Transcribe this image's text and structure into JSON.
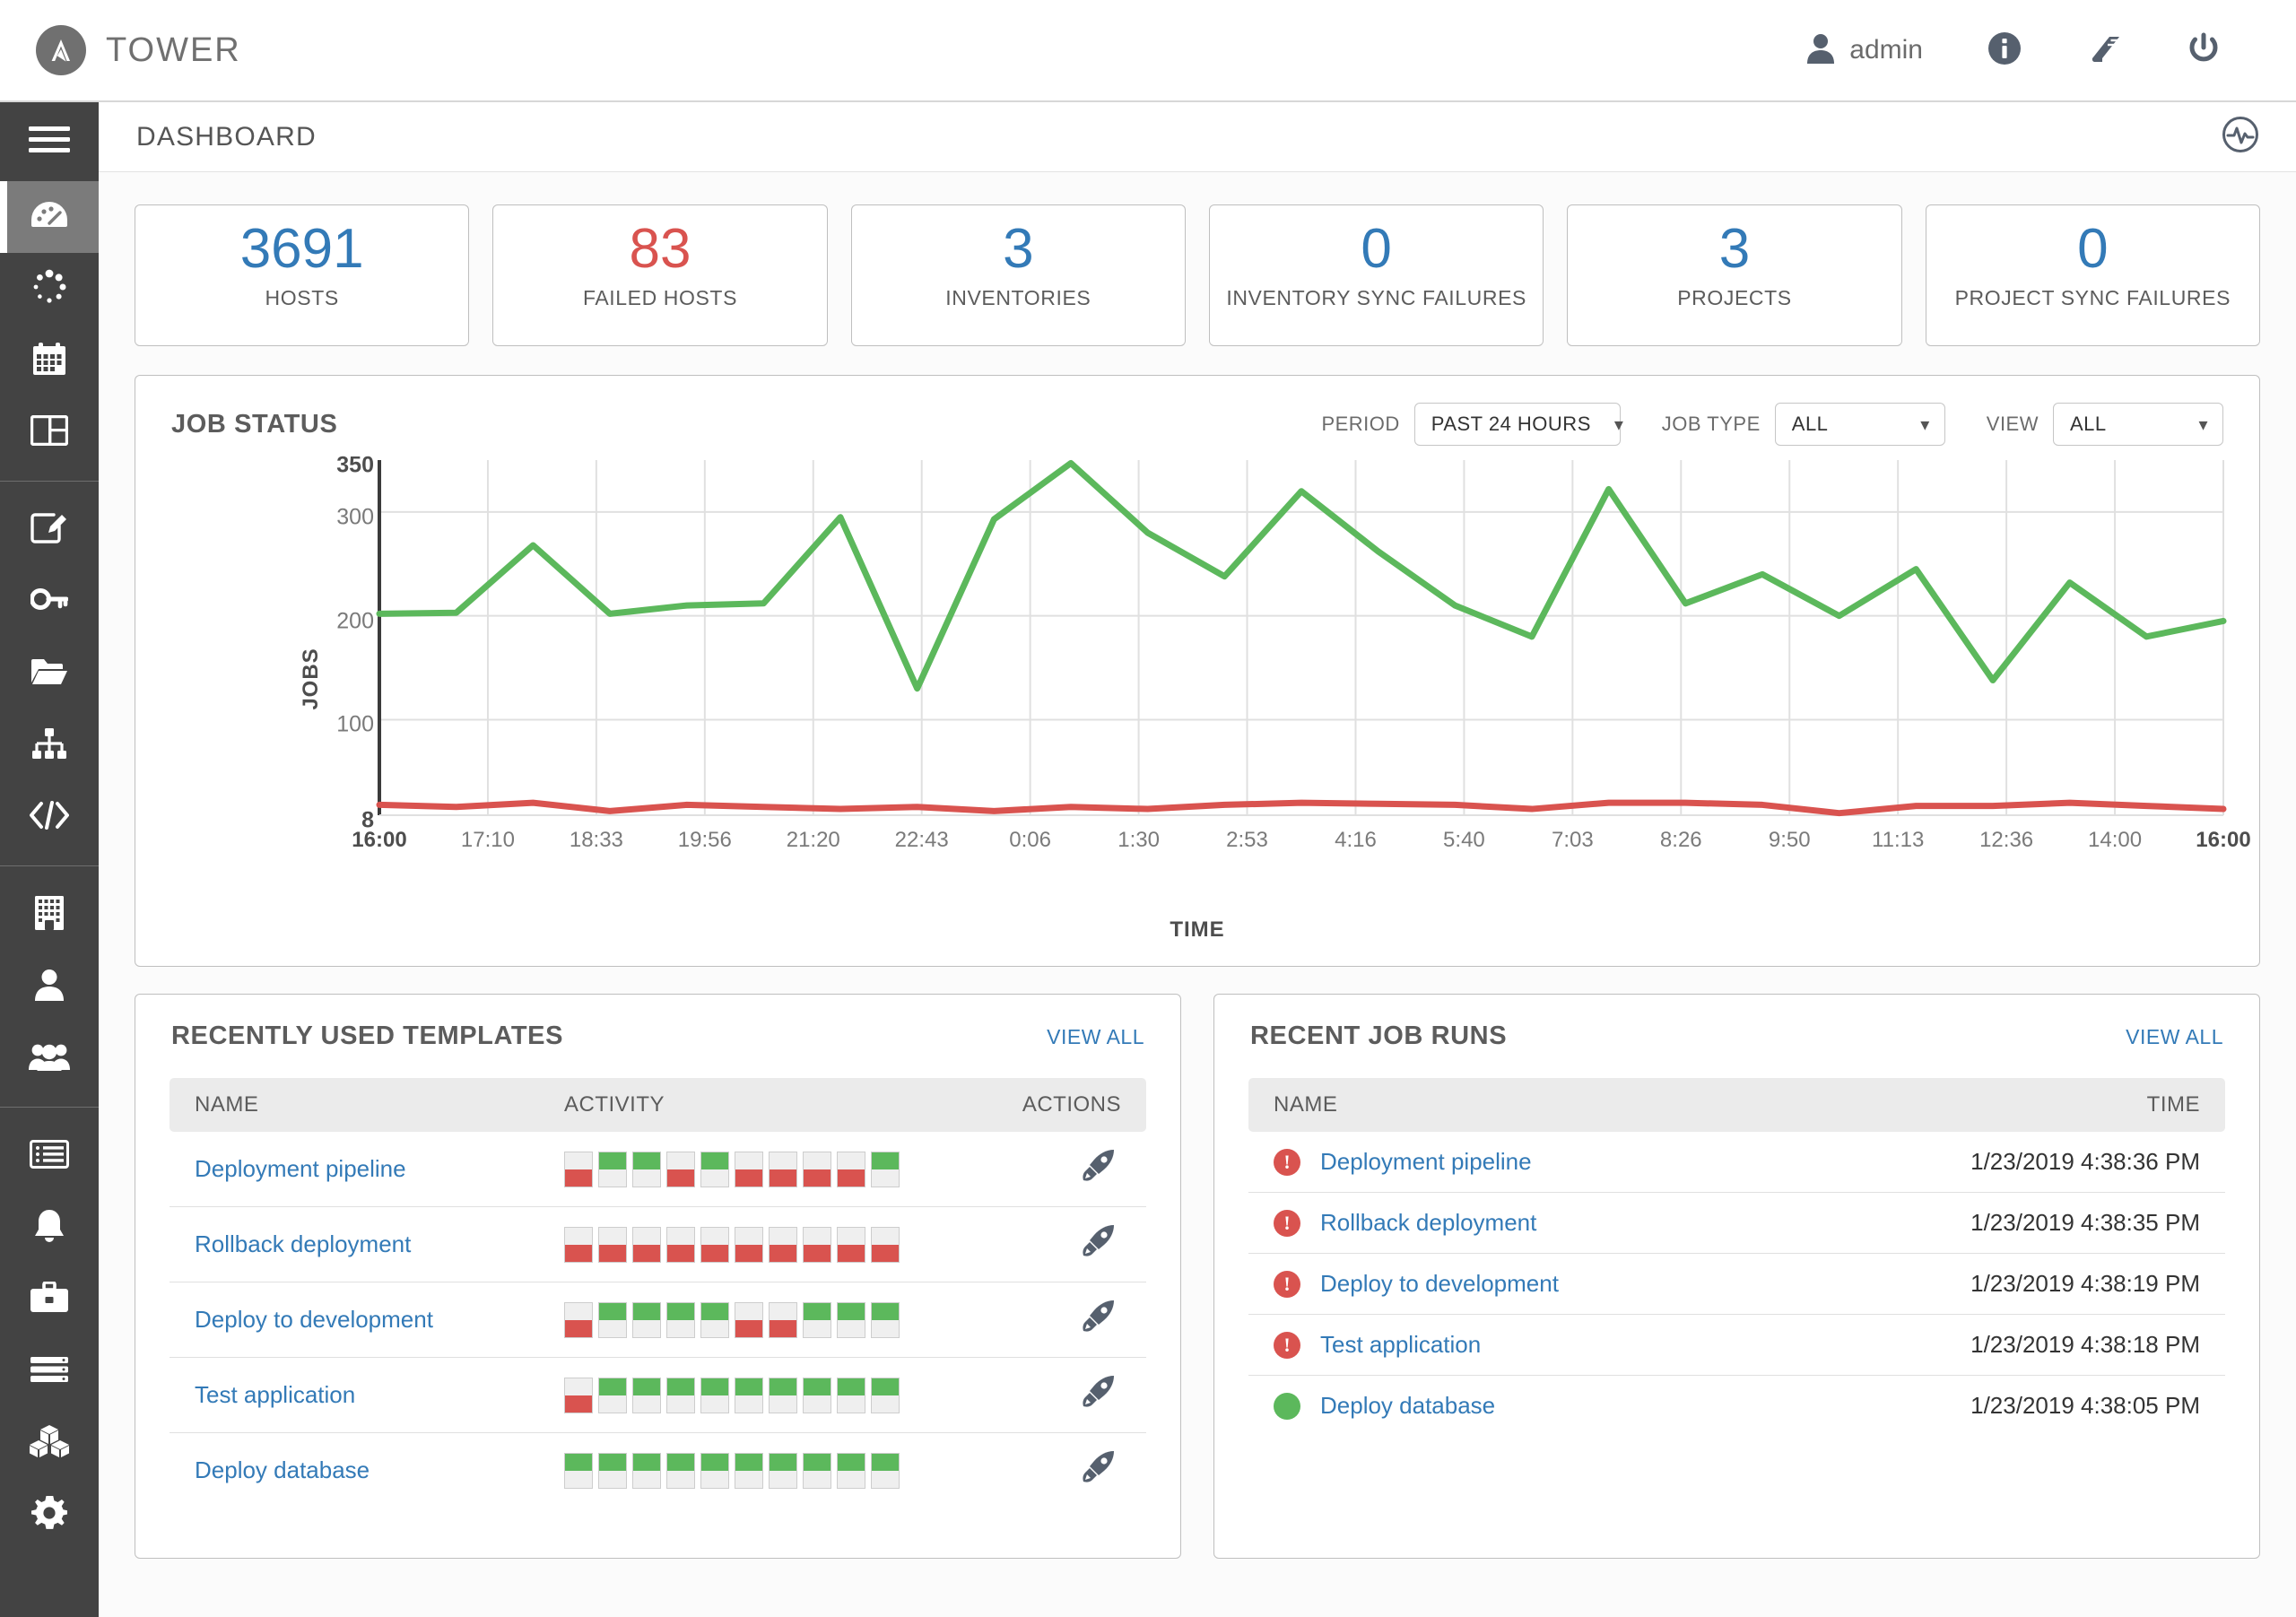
{
  "header": {
    "brand": "TOWER",
    "logo_icon": "ansible-logo-icon",
    "user_label": "admin",
    "user_icon": "user-icon",
    "info_icon": "info-circle-icon",
    "docs_icon": "book-icon",
    "logout_icon": "power-icon"
  },
  "sidebar": {
    "menu_icon": "hamburger-icon",
    "items": [
      {
        "name": "dashboard",
        "icon": "dashboard-gauge-icon",
        "active": true
      },
      {
        "name": "jobs",
        "icon": "jobs-dots-icon",
        "active": false
      },
      {
        "name": "schedules",
        "icon": "calendar-icon",
        "active": false
      },
      {
        "name": "portal-mode",
        "icon": "columns-icon",
        "active": false
      },
      {
        "name": "templates",
        "icon": "pencil-square-icon",
        "active": false,
        "sep_before": true
      },
      {
        "name": "credentials",
        "icon": "key-icon",
        "active": false
      },
      {
        "name": "projects",
        "icon": "folder-open-icon",
        "active": false
      },
      {
        "name": "inventories",
        "icon": "sitemap-icon",
        "active": false
      },
      {
        "name": "inventory-scripts",
        "icon": "code-icon",
        "active": false
      },
      {
        "name": "organizations",
        "icon": "building-icon",
        "active": false,
        "sep_before": true
      },
      {
        "name": "users",
        "icon": "user-icon",
        "active": false
      },
      {
        "name": "teams",
        "icon": "users-group-icon",
        "active": false
      },
      {
        "name": "management-jobs",
        "icon": "list-icon",
        "active": false,
        "sep_before": true
      },
      {
        "name": "notifications",
        "icon": "bell-icon",
        "active": false
      },
      {
        "name": "instance-groups",
        "icon": "briefcase-icon",
        "active": false
      },
      {
        "name": "applications",
        "icon": "server-stack-icon",
        "active": false
      },
      {
        "name": "integrations",
        "icon": "cubes-icon",
        "active": false
      },
      {
        "name": "settings",
        "icon": "gear-icon",
        "active": false
      }
    ]
  },
  "breadcrumb": {
    "title": "DASHBOARD",
    "activity_icon": "activity-stream-icon"
  },
  "stats": [
    {
      "value": "3691",
      "label": "HOSTS",
      "color": "blue"
    },
    {
      "value": "83",
      "label": "FAILED HOSTS",
      "color": "red"
    },
    {
      "value": "3",
      "label": "INVENTORIES",
      "color": "blue"
    },
    {
      "value": "0",
      "label": "INVENTORY SYNC FAILURES",
      "color": "blue"
    },
    {
      "value": "3",
      "label": "PROJECTS",
      "color": "blue"
    },
    {
      "value": "0",
      "label": "PROJECT SYNC FAILURES",
      "color": "blue"
    }
  ],
  "job_status": {
    "title": "JOB STATUS",
    "filters": [
      {
        "name": "period",
        "label": "PERIOD",
        "value": "PAST 24 HOURS"
      },
      {
        "name": "job-type",
        "label": "JOB TYPE",
        "value": "ALL"
      },
      {
        "name": "view",
        "label": "VIEW",
        "value": "ALL"
      }
    ]
  },
  "chart_data": {
    "type": "line",
    "title": "JOB STATUS",
    "xlabel": "TIME",
    "ylabel": "JOBS",
    "ylim": [
      8,
      350
    ],
    "yticks": [
      8,
      100,
      200,
      300,
      350
    ],
    "ytick_labels": [
      "8",
      "100",
      "200",
      "300",
      "350"
    ],
    "grid": true,
    "legend": "none",
    "x": [
      "16:00",
      "17:10",
      "18:33",
      "19:56",
      "21:20",
      "22:43",
      "0:06",
      "1:30",
      "2:53",
      "4:16",
      "5:40",
      "7:03",
      "8:26",
      "9:50",
      "11:13",
      "12:36",
      "14:00",
      "16:00"
    ],
    "xtick_bold": [
      0,
      17
    ],
    "series": [
      {
        "name": "successful",
        "color": "#5cb85c",
        "values": [
          202,
          203,
          268,
          202,
          210,
          212,
          295,
          130,
          293,
          347,
          280,
          238,
          320,
          262,
          210,
          180,
          322,
          212,
          240,
          200,
          245,
          138,
          232,
          180,
          195
        ]
      },
      {
        "name": "failed",
        "color": "#d9534f",
        "values": [
          18,
          16,
          20,
          12,
          18,
          16,
          14,
          16,
          12,
          16,
          14,
          18,
          20,
          19,
          18,
          14,
          20,
          20,
          18,
          10,
          17,
          17,
          20,
          17,
          14
        ]
      }
    ]
  },
  "templates_panel": {
    "title": "RECENTLY USED TEMPLATES",
    "view_all": "VIEW ALL",
    "columns": [
      "NAME",
      "ACTIVITY",
      "ACTIONS"
    ],
    "launch_icon": "rocket-icon",
    "rows": [
      {
        "name": "Deployment pipeline",
        "activity": [
          "fail",
          "ok",
          "ok",
          "fail",
          "ok",
          "fail",
          "fail",
          "fail",
          "fail",
          "ok"
        ]
      },
      {
        "name": "Rollback deployment",
        "activity": [
          "fail",
          "fail",
          "fail",
          "fail",
          "fail",
          "fail",
          "fail",
          "fail",
          "fail",
          "fail"
        ]
      },
      {
        "name": "Deploy to development",
        "activity": [
          "fail",
          "ok",
          "ok",
          "ok",
          "ok",
          "fail",
          "fail",
          "ok",
          "ok",
          "ok"
        ]
      },
      {
        "name": "Test application",
        "activity": [
          "fail",
          "ok",
          "ok",
          "ok",
          "ok",
          "ok",
          "ok",
          "ok",
          "ok",
          "ok"
        ]
      },
      {
        "name": "Deploy database",
        "activity": [
          "ok",
          "ok",
          "ok",
          "ok",
          "ok",
          "ok",
          "ok",
          "ok",
          "ok",
          "ok"
        ]
      }
    ]
  },
  "jobs_panel": {
    "title": "RECENT JOB RUNS",
    "view_all": "VIEW ALL",
    "columns": [
      "NAME",
      "TIME"
    ],
    "rows": [
      {
        "name": "Deployment pipeline",
        "time": "1/23/2019 4:38:36 PM",
        "status": "failed"
      },
      {
        "name": "Rollback deployment",
        "time": "1/23/2019 4:38:35 PM",
        "status": "failed"
      },
      {
        "name": "Deploy to development",
        "time": "1/23/2019 4:38:19 PM",
        "status": "failed"
      },
      {
        "name": "Test application",
        "time": "1/23/2019 4:38:18 PM",
        "status": "failed"
      },
      {
        "name": "Deploy database",
        "time": "1/23/2019 4:38:05 PM",
        "status": "ok"
      }
    ]
  },
  "colors": {
    "accent_blue": "#337ab7",
    "danger_red": "#d9534f",
    "success_green": "#5cb85c",
    "sidebar_bg": "#434343",
    "sidebar_active": "#7b7b7b"
  }
}
